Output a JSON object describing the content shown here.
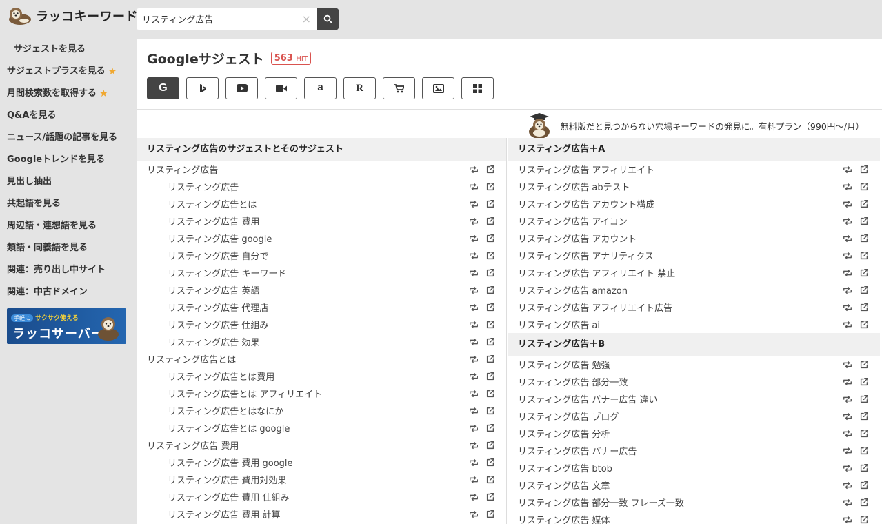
{
  "app": {
    "logo_text": "ラッコキーワード"
  },
  "search": {
    "value": "リスティング広告",
    "clear_glyph": "×"
  },
  "sidebar": {
    "items": [
      {
        "label": "サジェストを見る",
        "star": false
      },
      {
        "label": "サジェストプラスを見る",
        "star": true
      },
      {
        "label": "月間検索数を取得する",
        "star": true
      },
      {
        "label": "Q&Aを見る",
        "star": false
      },
      {
        "label": "ニュース/話題の記事を見る",
        "star": false
      },
      {
        "label": "Googleトレンドを見る",
        "star": false
      },
      {
        "label": "見出し抽出",
        "star": false
      },
      {
        "label": "共起語を見る",
        "star": false
      },
      {
        "label": "周辺語・連想語を見る",
        "star": false
      },
      {
        "label": "類語・同義語を見る",
        "star": false
      },
      {
        "label": "関連：売り出し中サイト",
        "star": false
      },
      {
        "label": "関連：中古ドメイン",
        "star": false
      }
    ],
    "banner": {
      "tag_pill": "手軽に",
      "tag_text": "サクサク使える",
      "title": "ラッコサーバー"
    }
  },
  "main": {
    "title": "Googleサジェスト",
    "hit_count": "563",
    "hit_unit": "HIT",
    "engines": [
      {
        "name": "google",
        "glyph": "G",
        "active": true
      },
      {
        "name": "bing",
        "glyph": "b",
        "active": false
      },
      {
        "name": "youtube",
        "glyph": "▶",
        "active": false
      },
      {
        "name": "video",
        "glyph": "■",
        "active": false
      },
      {
        "name": "amazon",
        "glyph": "a",
        "active": false
      },
      {
        "name": "rakuten",
        "glyph": "R",
        "active": false
      },
      {
        "name": "shopping",
        "glyph": "cart",
        "active": false
      },
      {
        "name": "image",
        "glyph": "img",
        "active": false
      },
      {
        "name": "apps",
        "glyph": "grid",
        "active": false
      }
    ],
    "promo": "無料版だと見つからない穴場キーワードの発見に。有料プラン（990円〜/月）"
  },
  "left_column": {
    "header": "リスティング広告のサジェストとそのサジェスト",
    "rows": [
      {
        "text": "リスティング広告",
        "level": 0
      },
      {
        "text": "リスティング広告",
        "level": 1
      },
      {
        "text": "リスティング広告とは",
        "level": 1
      },
      {
        "text": "リスティング広告 費用",
        "level": 1
      },
      {
        "text": "リスティング広告 google",
        "level": 1
      },
      {
        "text": "リスティング広告 自分で",
        "level": 1
      },
      {
        "text": "リスティング広告 キーワード",
        "level": 1
      },
      {
        "text": "リスティング広告 英語",
        "level": 1
      },
      {
        "text": "リスティング広告 代理店",
        "level": 1
      },
      {
        "text": "リスティング広告 仕組み",
        "level": 1
      },
      {
        "text": "リスティング広告 効果",
        "level": 1
      },
      {
        "text": "リスティング広告とは",
        "level": 0
      },
      {
        "text": "リスティング広告とは費用",
        "level": 1
      },
      {
        "text": "リスティング広告とは アフィリエイト",
        "level": 1
      },
      {
        "text": "リスティング広告とはなにか",
        "level": 1
      },
      {
        "text": "リスティング広告とは google",
        "level": 1
      },
      {
        "text": "リスティング広告 費用",
        "level": 0
      },
      {
        "text": "リスティング広告 費用 google",
        "level": 1
      },
      {
        "text": "リスティング広告 費用対効果",
        "level": 1
      },
      {
        "text": "リスティング広告 費用 仕組み",
        "level": 1
      },
      {
        "text": "リスティング広告 費用 計算",
        "level": 1
      }
    ]
  },
  "right_column": {
    "sections": [
      {
        "header": "リスティング広告＋A",
        "rows": [
          "リスティング広告 アフィリエイト",
          "リスティング広告 abテスト",
          "リスティング広告 アカウント構成",
          "リスティング広告 アイコン",
          "リスティング広告 アカウント",
          "リスティング広告 アナリティクス",
          "リスティング広告 アフィリエイト 禁止",
          "リスティング広告 amazon",
          "リスティング広告 アフィリエイト広告",
          "リスティング広告 ai"
        ]
      },
      {
        "header": "リスティング広告＋B",
        "rows": [
          "リスティング広告 勉強",
          "リスティング広告 部分一致",
          "リスティング広告 バナー広告 違い",
          "リスティング広告 ブログ",
          "リスティング広告 分析",
          "リスティング広告 バナー広告",
          "リスティング広告 btob",
          "リスティング広告 文章",
          "リスティング広告 部分一致 フレーズ一致",
          "リスティング広告 媒体"
        ]
      }
    ]
  },
  "colors": {
    "accent": "#444444",
    "hit": "#d9534f",
    "star": "#f0a830",
    "banner": "#1a4c8c"
  }
}
